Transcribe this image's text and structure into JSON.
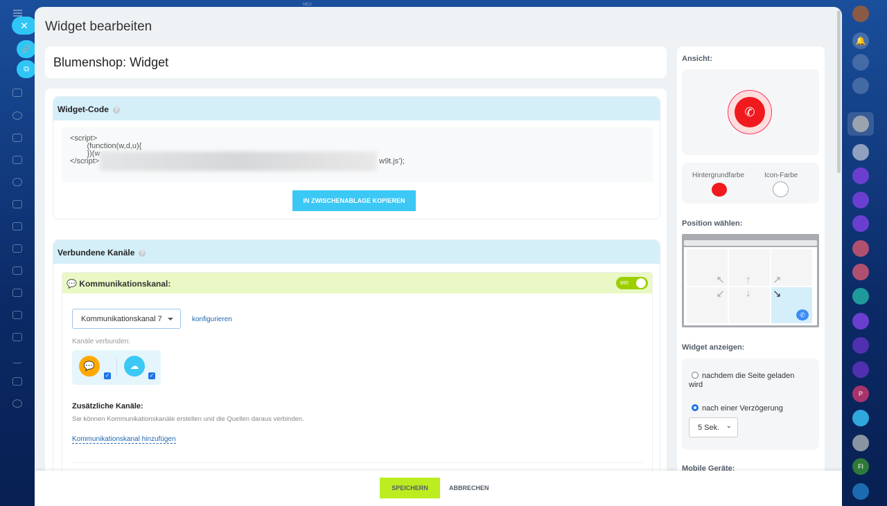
{
  "top": {
    "new_label": "NEU"
  },
  "modal": {
    "title": "Widget bearbeiten",
    "widget_name": "Blumenshop: Widget"
  },
  "widget_code": {
    "heading": "Widget-Code",
    "help": "?",
    "code_lines": [
      "<script>",
      "        (function(w,d,u){",
      "",
      "        })(w",
      "</script>"
    ],
    "code_tail": "w9t.js');",
    "copy_button": "IN ZWISCHENABLAGE KOPIEREN"
  },
  "channels": {
    "heading": "Verbundene Kanäle",
    "help": "?",
    "channel_header": "Kommunikationskanal:",
    "toggle": "ein",
    "selected_channel": "Kommunikationskanal 7",
    "configure_link": "konfigurieren",
    "connected_label": "Kanäle verbunden:",
    "additional_heading": "Zusätzliche Kanäle:",
    "additional_text": "Sie können Kommunikationskanäle erstellen und die Quellen daraus verbinden.",
    "add_link": "Kommunikationskanal hinzufügen"
  },
  "side": {
    "view_label": "Ansicht:",
    "bg_color_label": "Hintergrundfarbe",
    "icon_color_label": "Icon-Farbe",
    "bg_color": "#f0191e",
    "icon_color": "#ffffff",
    "position_label": "Position wählen:",
    "position_selected": "bottom-right",
    "show_label": "Widget anzeigen:",
    "option_after_load": "nachdem die Seite geladen wird",
    "option_delay": "nach einer Verzögerung",
    "delay_value": "5 Sek.",
    "mobile_label": "Mobile Geräte:"
  },
  "footer": {
    "save": "SPEICHERN",
    "cancel": "ABBRECHEN"
  },
  "right_sidebar": {
    "initials_p": "P",
    "initials_fi": "FI"
  }
}
